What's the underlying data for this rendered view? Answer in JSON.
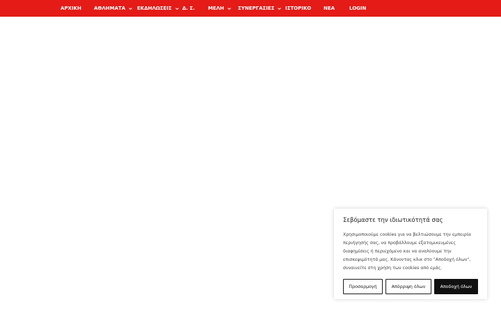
{
  "nav": {
    "items": [
      {
        "label": "ΑΡΧΙΚΗ",
        "has_dropdown": false
      },
      {
        "label": "ΑΘΛΗΜΑΤΑ",
        "has_dropdown": true
      },
      {
        "label": "ΕΚΔΗΛΩΣΕΙΣ",
        "has_dropdown": true
      },
      {
        "label": "Δ. Σ.",
        "has_dropdown": false
      },
      {
        "label": "ΜΕΛΗ",
        "has_dropdown": true
      },
      {
        "label": "ΣΥΝΕΡΓΑΣΙΕΣ",
        "has_dropdown": true
      },
      {
        "label": "ΙΣΤΟΡΙΚΟ",
        "has_dropdown": false
      },
      {
        "label": "ΝΕΑ",
        "has_dropdown": false
      },
      {
        "label": "LOGIN",
        "has_dropdown": false
      }
    ],
    "background_color": "#e41b17"
  },
  "cookie_banner": {
    "title": "Σεβόμαστε την ιδιωτικότητά σας",
    "text_lines": [
      "Χρησιμοποιούμε cookies για να βελτιώσουμε την εμπειρία",
      "περιήγησής σας, να προβάλλουμε εξατομικευμένες",
      "διαφημίσεις ή περιεχόμενο και να αναλύουμε την",
      "επισκεψιμότητά μας. Κάνοντας κλικ στο \"Αποδοχή όλων\",",
      "συναινείτε στη χρήση των cookies από εμάς."
    ],
    "customize_label": "Προσαρμογή",
    "reject_label": "Απόρριψη όλων",
    "accept_label": "Αποδοχή όλων"
  }
}
